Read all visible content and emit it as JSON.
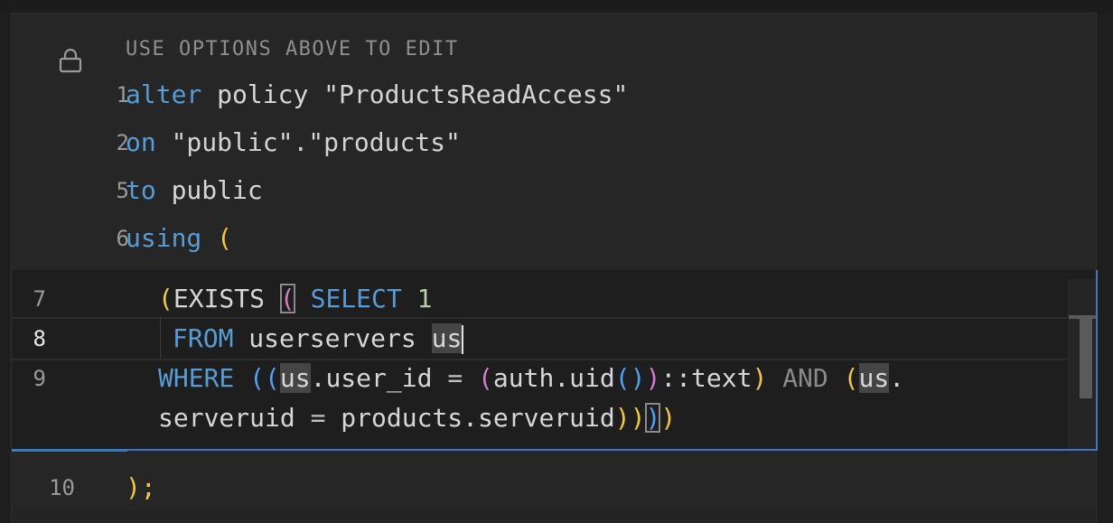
{
  "editor": {
    "readonly_notice": "USE OPTIONS ABOVE TO EDIT",
    "lines": [
      {
        "num": "1",
        "tokens": [
          "alter",
          " policy ",
          "\"ProductsReadAccess\""
        ]
      },
      {
        "num": "2",
        "tokens": [
          "on",
          " \"public\".\"products\""
        ]
      },
      {
        "num": "5",
        "tokens": [
          "to",
          " public"
        ]
      },
      {
        "num": "6",
        "tokens": [
          "using",
          " ",
          "("
        ]
      }
    ],
    "inner_lines": {
      "l7": {
        "num": "7",
        "open": "(",
        "exists": "EXISTS ",
        "paren": "(",
        "select": " SELECT ",
        "one": "1"
      },
      "l8": {
        "num": "8",
        "from": "FROM",
        "table": " userservers ",
        "alias": "us"
      },
      "l9": {
        "num": "9",
        "where": "WHERE",
        "p1": " ((",
        "us1": "us",
        "col1": ".user_id ",
        "eq1": "=",
        "p2": " (",
        "fn": "auth.uid",
        "p3": "()",
        "p4": ")",
        "cast": "::text",
        "p5": ")",
        "and": " AND ",
        "p6": "(",
        "us2": "us",
        "dot": "."
      },
      "l9b": {
        "col2": "serveruid ",
        "eq2": "=",
        "rhs": " products.serveruid",
        "p7": "))",
        "p8": ")",
        "p9": ")"
      }
    },
    "last_line": {
      "num": "10",
      "text": ");"
    }
  },
  "colors": {
    "keyword": "#569cd6",
    "paren_yellow": "#f3c741",
    "paren_pink": "#d67ad2",
    "paren_blue": "#4ea1f5",
    "focus_border": "#3a78c4"
  },
  "icons": {
    "lock": "lock-icon"
  }
}
